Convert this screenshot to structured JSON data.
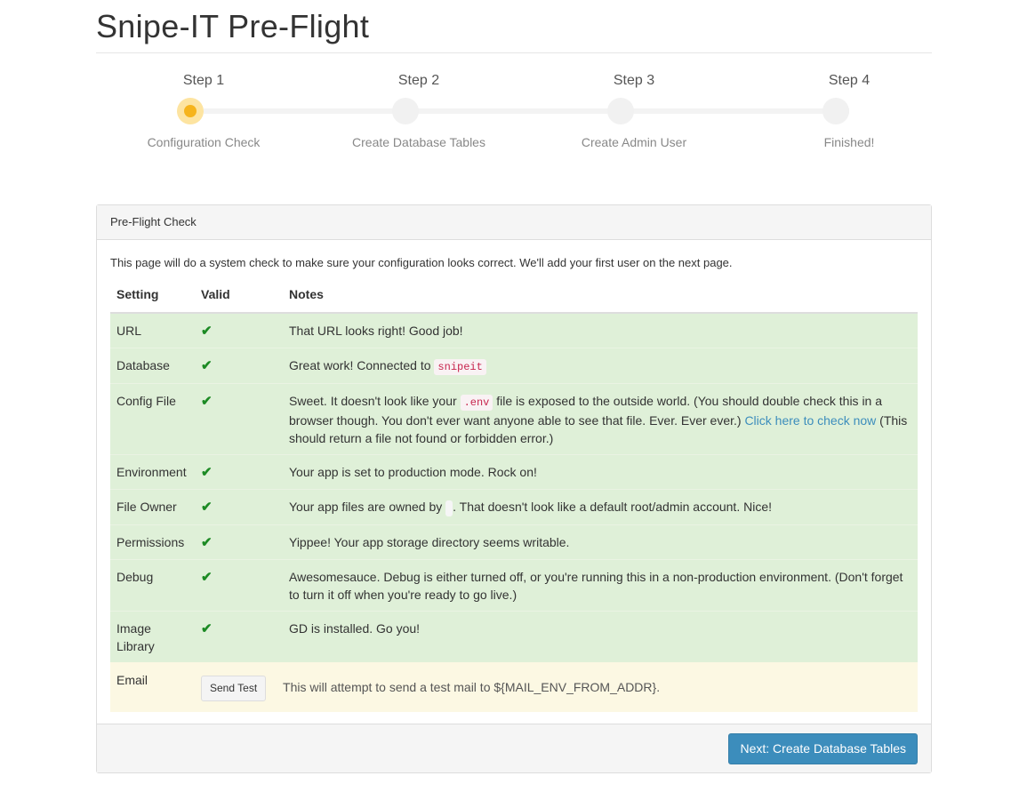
{
  "page": {
    "title": "Snipe-IT Pre-Flight"
  },
  "steps": [
    {
      "label": "Step 1",
      "caption": "Configuration Check",
      "active": true
    },
    {
      "label": "Step 2",
      "caption": "Create Database Tables",
      "active": false
    },
    {
      "label": "Step 3",
      "caption": "Create Admin User",
      "active": false
    },
    {
      "label": "Step 4",
      "caption": "Finished!",
      "active": false
    }
  ],
  "panel": {
    "heading": "Pre-Flight Check",
    "intro": "This page will do a system check to make sure your configuration looks correct. We'll add your first user on the next page.",
    "columns": {
      "setting": "Setting",
      "valid": "Valid",
      "notes": "Notes"
    },
    "rows": {
      "url": {
        "setting": "URL",
        "note": "That URL looks right! Good job!"
      },
      "database": {
        "setting": "Database",
        "note_pre": "Great work! Connected to ",
        "code": "snipeit"
      },
      "config": {
        "setting": "Config File",
        "note_pre": "Sweet. It doesn't look like your ",
        "code": ".env",
        "note_mid": " file is exposed to the outside world. (You should double check this in a browser though. You don't ever want anyone able to see that file. Ever. Ever ever.) ",
        "link": "Click here to check now",
        "note_post": " (This should return a file not found or forbidden error.)"
      },
      "environment": {
        "setting": "Environment",
        "note": "Your app is set to production mode. Rock on!"
      },
      "owner": {
        "setting": "File Owner",
        "note_pre": "Your app files are owned by ",
        "note_post": ". That doesn't look like a default root/admin account. Nice!"
      },
      "permissions": {
        "setting": "Permissions",
        "note": "Yippee! Your app storage directory seems writable."
      },
      "debug": {
        "setting": "Debug",
        "note": "Awesomesauce. Debug is either turned off, or you're running this in a non-production environment. (Don't forget to turn it off when you're ready to go live.)"
      },
      "image": {
        "setting": "Image Library",
        "note": "GD is installed. Go you!"
      },
      "email": {
        "setting": "Email",
        "button": "Send Test",
        "note": "This will attempt to send a test mail to ${MAIL_ENV_FROM_ADDR}."
      }
    },
    "next_button": "Next: Create Database Tables"
  },
  "icons": {
    "valid": "check-icon"
  },
  "colors": {
    "success_row": "#dff0d8",
    "warning_row": "#fcf8e3",
    "active_step": "#f6b41c",
    "primary": "#3c8dbc"
  }
}
